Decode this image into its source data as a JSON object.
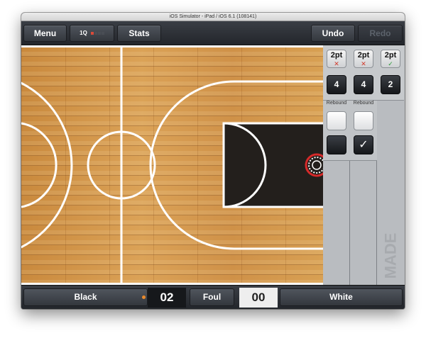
{
  "window": {
    "title": "iOS Simulator - iPad / iOS 6.1 (108141)"
  },
  "toolbar": {
    "menu_label": "Menu",
    "quarter_label": "1Q",
    "quarter_indicator": {
      "current": 1,
      "total": 4
    },
    "stats_label": "Stats",
    "undo_label": "Undo",
    "redo_label": "Redo"
  },
  "shot_panel": {
    "columns": [
      {
        "shot": "2pt",
        "result": "✕",
        "result_state": "missed",
        "number": "4",
        "rebound_label": "Rebound",
        "rebound_check": ""
      },
      {
        "shot": "2pt",
        "result": "✕",
        "result_state": "missed",
        "number": "4",
        "rebound_label": "Rebound",
        "rebound_check": "✓"
      },
      {
        "shot": "2pt",
        "result": "✓",
        "result_state": "made",
        "number": "2"
      }
    ],
    "status_label": "MADE"
  },
  "scoreboard": {
    "home_team": "Black",
    "home_score": "02",
    "foul_label": "Foul",
    "away_score": "00",
    "away_team": "White",
    "possession": "home"
  },
  "colors": {
    "court_wood": "#d49a4e",
    "court_lines": "#ffffff",
    "paint": "#231f1c",
    "chrome_dark": "#2a2d33",
    "panel_gray": "#b9bcc0",
    "miss_red": "#d23a2c",
    "made_green": "#2e9c3a",
    "possession_orange": "#e98a2c"
  }
}
